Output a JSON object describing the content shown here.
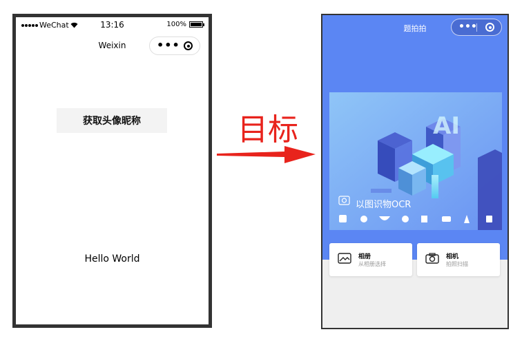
{
  "left_phone": {
    "status": {
      "carrier": "WeChat",
      "time": "13:16",
      "battery": "100%"
    },
    "nav_title": "Weixin",
    "button_label": "获取头像昵称",
    "hello_text": "Hello World"
  },
  "target_label": "目标",
  "right_phone": {
    "title": "题拍拍",
    "banner_caption": "以图识物OCR",
    "cards": [
      {
        "title": "相册",
        "subtitle": "从相册选择",
        "icon": "image-icon"
      },
      {
        "title": "相机",
        "subtitle": "拍照扫描",
        "icon": "camera-icon"
      }
    ]
  },
  "colors": {
    "arrow": "#e8231c",
    "header_blue": "#5b86f3"
  }
}
